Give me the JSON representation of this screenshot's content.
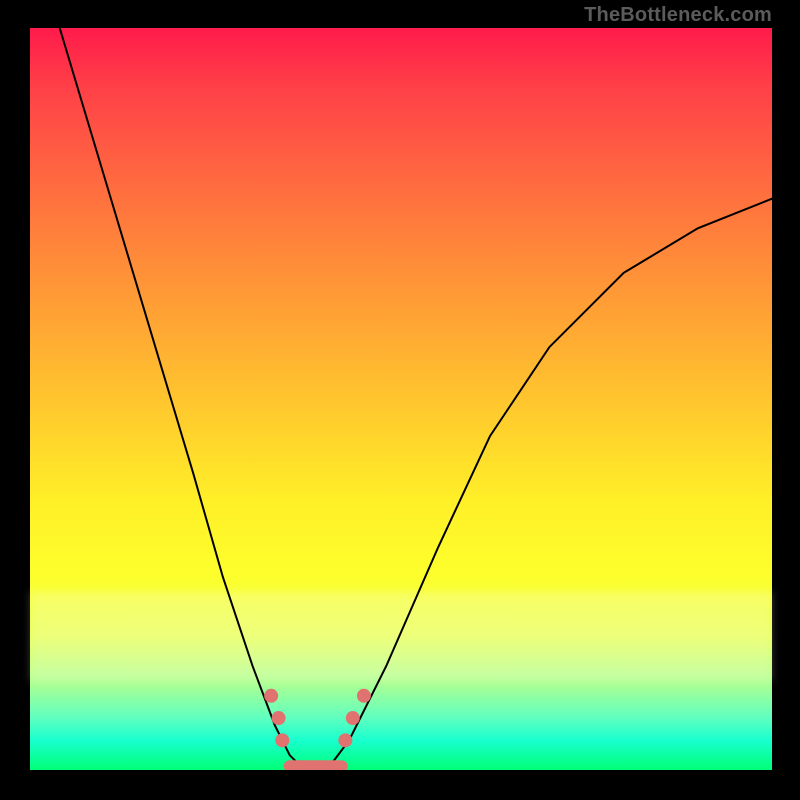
{
  "attribution": "TheBottleneck.com",
  "colors": {
    "frame_bg_top": "#ff1b4a",
    "frame_bg_bottom": "#00ff76",
    "border": "#000000",
    "curve": "#000000",
    "markers": "#e0736f",
    "attribution_text": "#5b5b5b"
  },
  "chart_data": {
    "type": "line",
    "title": "",
    "xlabel": "",
    "ylabel": "",
    "xlim": [
      0,
      100
    ],
    "ylim": [
      0,
      100
    ],
    "series": [
      {
        "name": "curve",
        "x": [
          4,
          10,
          16,
          22,
          26,
          30,
          33,
          35,
          37,
          40,
          43,
          48,
          55,
          62,
          70,
          80,
          90,
          100
        ],
        "y": [
          100,
          80,
          60,
          40,
          26,
          14,
          6,
          2,
          0,
          0,
          4,
          14,
          30,
          45,
          57,
          67,
          73,
          77
        ]
      }
    ],
    "markers": [
      {
        "x": 32.5,
        "y": 10
      },
      {
        "x": 33.5,
        "y": 7
      },
      {
        "x": 34.0,
        "y": 4
      },
      {
        "x": 42.5,
        "y": 4
      },
      {
        "x": 43.5,
        "y": 7
      },
      {
        "x": 45.0,
        "y": 10
      }
    ],
    "valley_band": {
      "x_start": 35,
      "x_end": 42,
      "y": 0.5
    }
  }
}
